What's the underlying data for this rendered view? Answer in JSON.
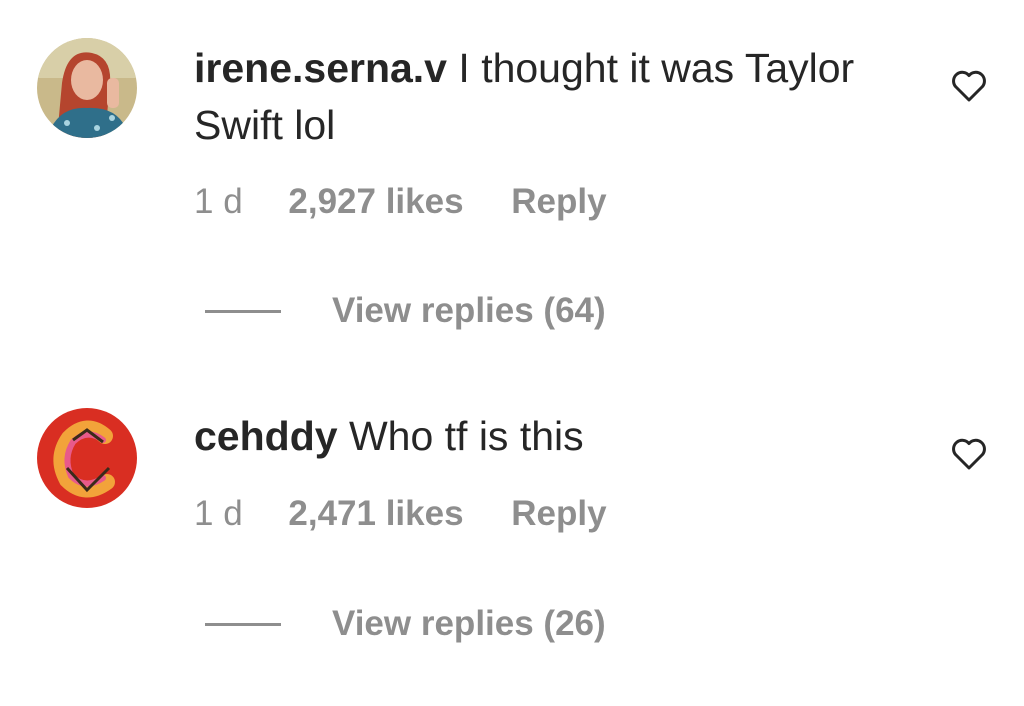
{
  "comments": [
    {
      "username": "irene.serna.v",
      "text": "I thought it was Taylor Swift lol",
      "time": "1 d",
      "likes": "2,927 likes",
      "reply": "Reply",
      "view_replies": "View replies (64)",
      "like_icon": "heart-outline-icon"
    },
    {
      "username": "cehddy",
      "text": "Who tf is this",
      "time": "1 d",
      "likes": "2,471 likes",
      "reply": "Reply",
      "view_replies": "View replies (26)",
      "like_icon": "heart-outline-icon"
    }
  ]
}
